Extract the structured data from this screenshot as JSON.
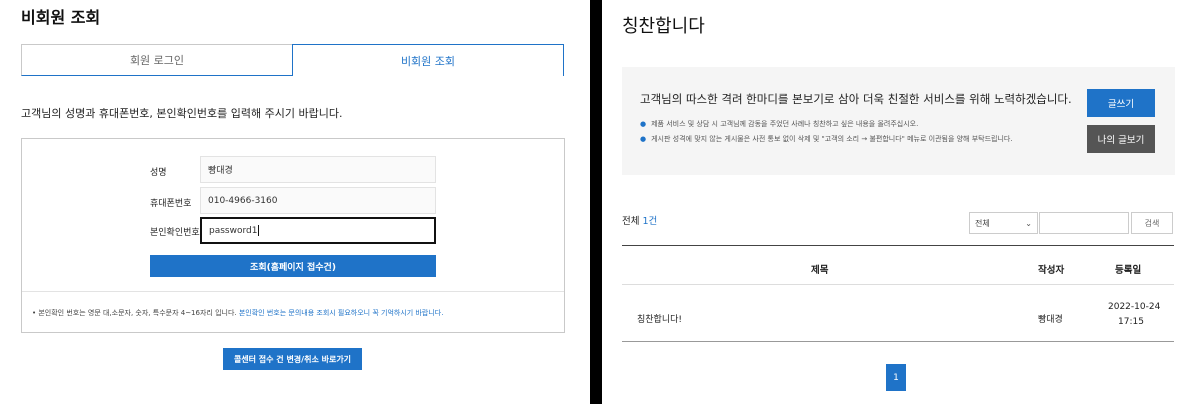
{
  "left": {
    "title": "비회원 조회",
    "tabs": [
      {
        "label": "회원 로그인",
        "active": false
      },
      {
        "label": "비회원 조회",
        "active": true
      }
    ],
    "instruction": "고객님의 성명과 휴대폰번호, 본인확인번호를 입력해 주시기 바랍니다.",
    "form": {
      "name_label": "성명",
      "name_value": "빵대경",
      "phone_label": "휴대폰번호",
      "phone_value": "010-4966-3160",
      "pin_label": "본인확인번호",
      "pin_value": "password1"
    },
    "lookup_button": "조회(홈페이지 접수건)",
    "note_prefix": "• 본인확인 번호는 영문 대,소문자, 숫자, 특수문자 4~16자리 입니다.",
    "note_highlight": "본인확인 번호는 문의내용 조회시 필요하오니 꼭 기억하시기 바랍니다.",
    "callcenter_button": "콜센터 접수 건 변경/취소 바로가기"
  },
  "right": {
    "title": "칭찬합니다",
    "info": {
      "headline": "고객님의 따스한 격려 한마디를 본보기로 삼아 더욱 친절한 서비스를 위해 노력하겠습니다.",
      "bullets": [
        "제품 서비스 및 상담 시 고객님께 감동을 주었던 사례나 칭찬하고 싶은 내용을 올려주십시오.",
        "게시판 성격에 맞지 않는 게시물은 사전 통보 없이 삭제 및 \"고객의 소리 → 불편합니다\" 메뉴로 이관됨을 양해 부탁드립니다."
      ],
      "write_button": "글쓰기",
      "my_posts_button": "나의 글보기"
    },
    "total_prefix": "전체",
    "total_count": "1건",
    "search": {
      "select_value": "전체",
      "input_value": "",
      "button": "검색"
    },
    "table": {
      "headers": {
        "title": "제목",
        "author": "작성자",
        "date": "등록일"
      },
      "rows": [
        {
          "title": "칭찬합니다!",
          "author": "빵대경",
          "date": "2022-10-24",
          "time": "17:15"
        }
      ]
    },
    "pagination": {
      "current": "1"
    }
  }
}
